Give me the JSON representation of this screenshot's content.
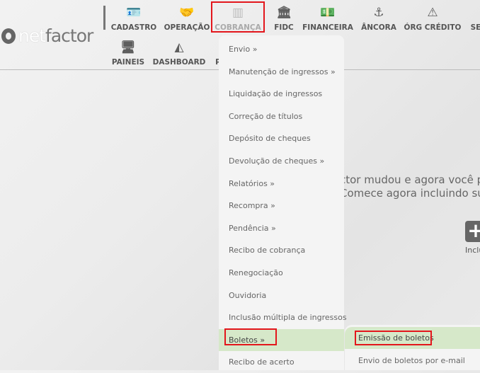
{
  "brand": {
    "logo_text_a": "net",
    "logo_text_b": "factor"
  },
  "nav_row1": [
    {
      "label": "CADASTRO",
      "icon": "id-card-icon",
      "glyph": "🪪"
    },
    {
      "label": "OPERAÇÃO",
      "icon": "handshake-icon",
      "glyph": "🤝"
    },
    {
      "label": "COBRANÇA",
      "icon": "barcode-icon",
      "glyph": "▥"
    },
    {
      "label": "FIDC",
      "icon": "bank-icon",
      "glyph": "🏛"
    },
    {
      "label": "FINANCEIRA",
      "icon": "money-bill-icon",
      "glyph": "💵"
    },
    {
      "label": "ÂNCORA",
      "icon": "anchor-icon",
      "glyph": "⚓"
    },
    {
      "label": "ÓRG CRÉDITO",
      "icon": "warning-icon",
      "glyph": "⚠"
    },
    {
      "label": "SE",
      "icon": "",
      "glyph": ""
    }
  ],
  "nav_row2": [
    {
      "label": "PAINEIS",
      "icon": "monitor-icon",
      "glyph": "🖥"
    },
    {
      "label": "DASHBOARD",
      "icon": "area-chart-icon",
      "glyph": "◭"
    },
    {
      "label": "P",
      "icon": "",
      "glyph": ""
    }
  ],
  "menu": [
    {
      "label": "Envio »"
    },
    {
      "label": "Manutenção de ingressos »"
    },
    {
      "label": "Liquidação de ingressos"
    },
    {
      "label": "Correção de títulos"
    },
    {
      "label": "Depósito de cheques"
    },
    {
      "label": "Devolução de cheques »"
    },
    {
      "label": "Relatórios »"
    },
    {
      "label": "Recompra »"
    },
    {
      "label": "Pendência »"
    },
    {
      "label": "Recibo de cobrança"
    },
    {
      "label": "Renegociação"
    },
    {
      "label": "Ouvidoria"
    },
    {
      "label": "Inclusão múltipla de ingressos"
    },
    {
      "label": "Boletos »"
    },
    {
      "label": "Recibo de acerto"
    }
  ],
  "submenu": [
    {
      "label": "Emissão de boletos"
    },
    {
      "label": "Envio de boletos por e-mail"
    }
  ],
  "background": {
    "line1": "ctor mudou e agora você p",
    "line2": "Comece agora incluindo su",
    "plus_label": "Inclu"
  },
  "colors": {
    "highlight": "#d6e8c9",
    "annotation": "#e3161c"
  }
}
